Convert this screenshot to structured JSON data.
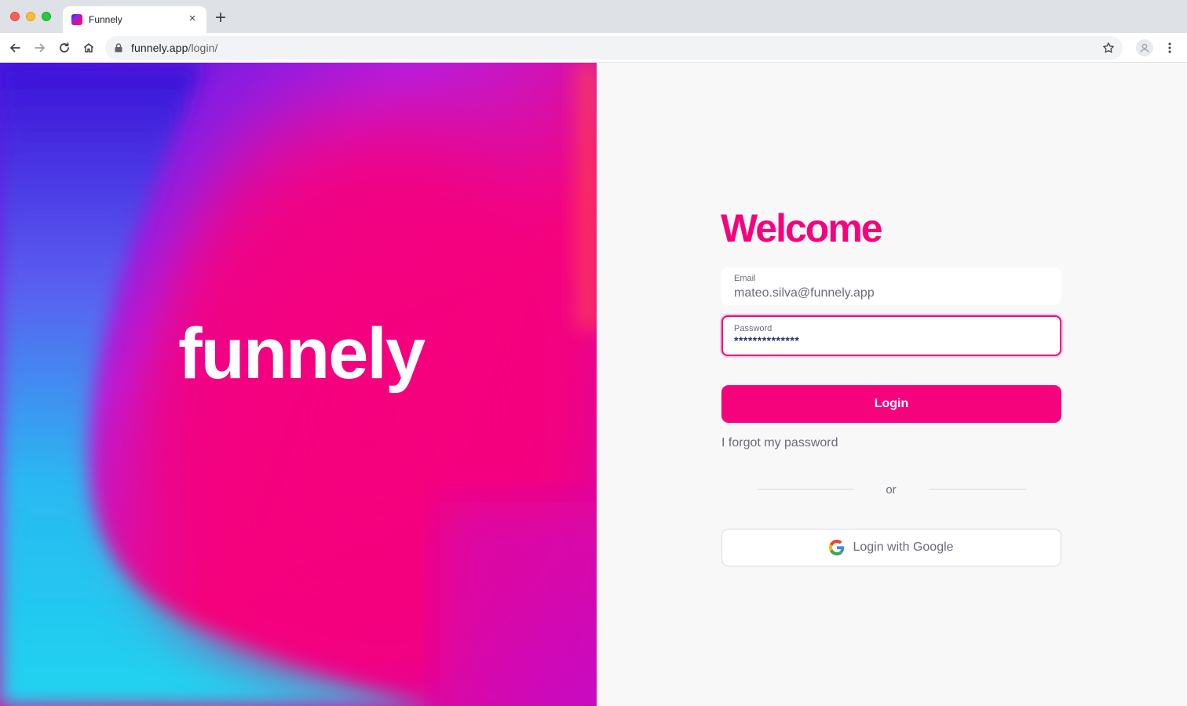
{
  "browser": {
    "tab_title": "Funnely",
    "tab_close": "×",
    "new_tab": "+",
    "url_host": "funnely.app",
    "url_path": "/login/"
  },
  "hero": {
    "brand": "funnely",
    "colors": {
      "pink": "#f5037d",
      "violet": "#7b2ff7",
      "cyan": "#1fd4f0"
    }
  },
  "login": {
    "title": "Welcome",
    "email_label": "Email",
    "email_value": "mateo.silva@funnely.app",
    "password_label": "Password",
    "password_value": "**************",
    "login_button": "Login",
    "forgot_link": "I forgot my password",
    "divider_text": "or",
    "google_button": "Login with Google",
    "accent_color": "#f5037d"
  }
}
